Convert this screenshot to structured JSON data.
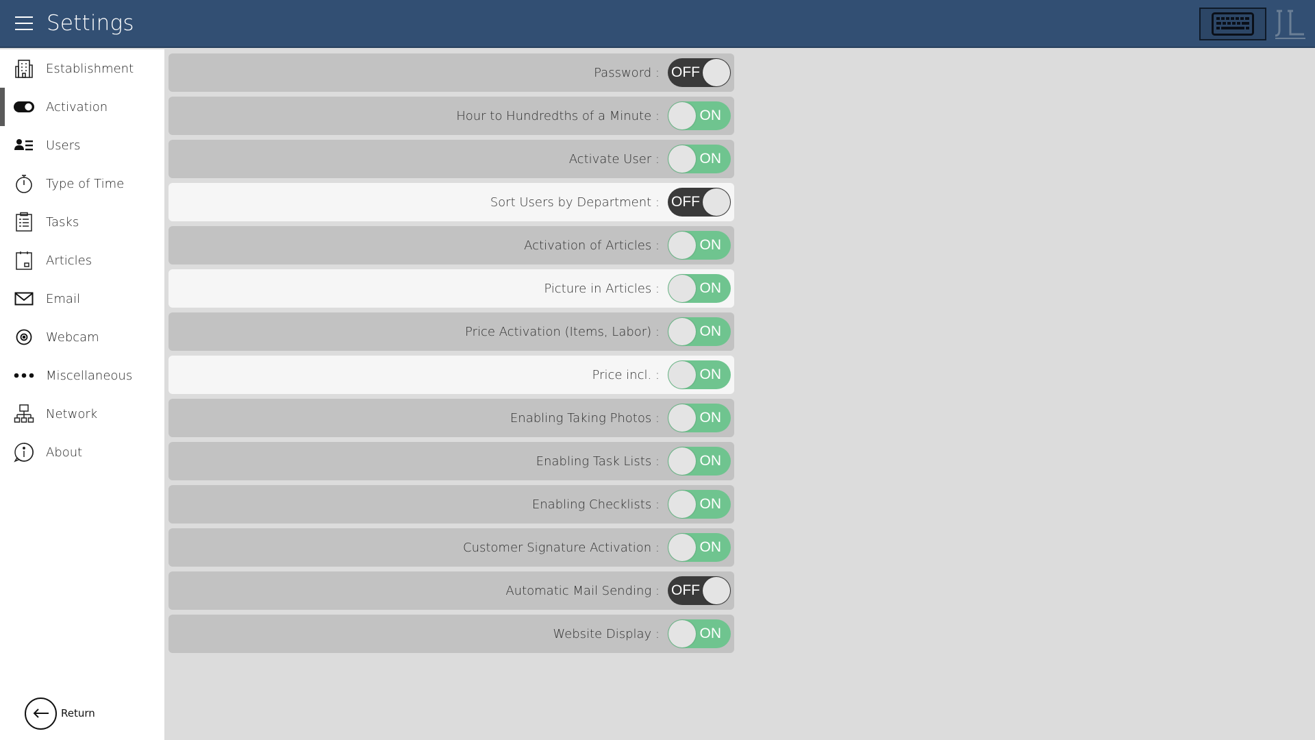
{
  "header": {
    "title": "Settings",
    "menu_icon": "hamburger-menu-icon",
    "keyboard_icon": "keyboard-icon",
    "logo_icon": "brand-logo"
  },
  "sidebar": {
    "items": [
      {
        "label": "Establishment",
        "icon": "building-icon",
        "active": false
      },
      {
        "label": "Activation",
        "icon": "toggle-icon",
        "active": true
      },
      {
        "label": "Users",
        "icon": "users-icon",
        "active": false
      },
      {
        "label": "Type of Time",
        "icon": "stopwatch-icon",
        "active": false
      },
      {
        "label": "Tasks",
        "icon": "clipboard-icon",
        "active": false
      },
      {
        "label": "Articles",
        "icon": "article-icon",
        "active": false
      },
      {
        "label": "Email",
        "icon": "envelope-icon",
        "active": false
      },
      {
        "label": "Webcam",
        "icon": "webcam-icon",
        "active": false
      },
      {
        "label": "Miscellaneous",
        "icon": "more-dots-icon",
        "active": false
      },
      {
        "label": "Network",
        "icon": "network-icon",
        "active": false
      },
      {
        "label": "About",
        "icon": "info-icon",
        "active": false
      }
    ],
    "return_label": "Return"
  },
  "toggle_labels": {
    "on": "ON",
    "off": "OFF"
  },
  "settings": [
    {
      "label": "Password :",
      "state": "off",
      "highlight": false
    },
    {
      "label": "Hour to Hundredths of a Minute :",
      "state": "on",
      "highlight": false
    },
    {
      "label": "Activate User :",
      "state": "on",
      "highlight": false
    },
    {
      "label": "Sort Users by Department :",
      "state": "off",
      "highlight": true
    },
    {
      "label": "Activation of Articles :",
      "state": "on",
      "highlight": false
    },
    {
      "label": "Picture in Articles :",
      "state": "on",
      "highlight": true
    },
    {
      "label": "Price Activation (Items, Labor) :",
      "state": "on",
      "highlight": false
    },
    {
      "label": "Price incl. :",
      "state": "on",
      "highlight": true
    },
    {
      "label": "Enabling Taking Photos :",
      "state": "on",
      "highlight": false
    },
    {
      "label": "Enabling Task Lists :",
      "state": "on",
      "highlight": false
    },
    {
      "label": "Enabling Checklists :",
      "state": "on",
      "highlight": false
    },
    {
      "label": "Customer Signature Activation :",
      "state": "on",
      "highlight": false
    },
    {
      "label": "Automatic Mail Sending :",
      "state": "off",
      "highlight": false
    },
    {
      "label": "Website Display :",
      "state": "on",
      "highlight": false
    }
  ],
  "colors": {
    "header_bg": "#324f73",
    "toggle_on": "#6fc48f",
    "toggle_off": "#3a3a3a",
    "row_bg": "#c2c2c2",
    "row_highlight_bg": "#f6f6f6",
    "content_bg": "#dcdcdc"
  }
}
